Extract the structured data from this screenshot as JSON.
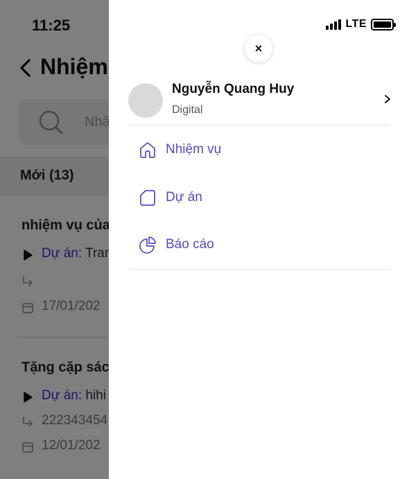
{
  "background": {
    "title": "Nhiệm v",
    "search_placeholder": "Nhậ",
    "tab_new": "Mới (13)",
    "tasks": [
      {
        "title": "nhiệm vụ của t",
        "project_key": "Dự án:",
        "project_value": " Tran",
        "subtask": "",
        "date": "17/01/202"
      },
      {
        "title": "Tặng cặp sách",
        "project_key": "Dự án:",
        "project_value": " hihi",
        "subtask": "222343454",
        "date": "12/01/202"
      }
    ]
  },
  "status_bar": {
    "time": "11:25",
    "network": "LTE"
  },
  "drawer": {
    "profile": {
      "name": "Nguyễn Quang Huy",
      "department": "Digital"
    },
    "menu": [
      {
        "label": "Nhiệm vụ",
        "icon": "home-icon"
      },
      {
        "label": "Dự án",
        "icon": "folder-icon"
      },
      {
        "label": "Báo cáo",
        "icon": "pie-chart-icon"
      }
    ]
  },
  "colors": {
    "accent": "#5646c4",
    "link": "#3a2fd1",
    "overlay": "#00000080"
  }
}
